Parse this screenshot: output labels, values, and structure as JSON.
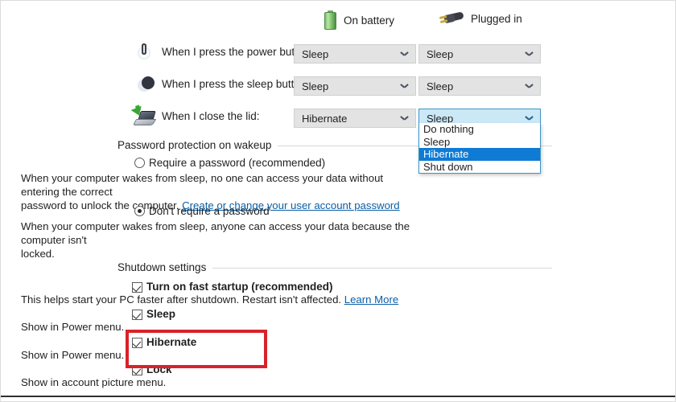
{
  "columns": [
    {
      "icon": "battery-icon",
      "label": "On battery"
    },
    {
      "icon": "power-plug-icon",
      "label": "Plugged in"
    }
  ],
  "setting_rows": [
    {
      "icon": "power-button-icon",
      "label": "When I press the power button:",
      "on_battery": "Sleep",
      "plugged_in": "Sleep"
    },
    {
      "icon": "sleep-button-icon",
      "label": "When I press the sleep button:",
      "on_battery": "Sleep",
      "plugged_in": "Sleep"
    },
    {
      "icon": "close-lid-icon",
      "label": "When I close the lid:",
      "on_battery": "Hibernate",
      "plugged_in": "Sleep"
    }
  ],
  "dropdown": {
    "open_for": "close-lid-plugged-in",
    "current_value": "Sleep",
    "highlighted": "Hibernate",
    "options": [
      "Do nothing",
      "Sleep",
      "Hibernate",
      "Shut down"
    ]
  },
  "password_section": {
    "title": "Password protection on wakeup",
    "options": [
      {
        "label": "Require a password (recommended)",
        "selected": false,
        "desc_part1": "When your computer wakes from sleep, no one can access your data without entering the correct",
        "desc_part2": "password to unlock the computer.",
        "link": "Create or change your user account password"
      },
      {
        "label": "Don't require a password",
        "selected": true,
        "desc_part1": "When your computer wakes from sleep, anyone can access your data because the computer isn't",
        "desc_part2": "locked.",
        "link": ""
      }
    ]
  },
  "shutdown_section": {
    "title": "Shutdown settings",
    "items": [
      {
        "label": "Turn on fast startup (recommended)",
        "checked": true,
        "desc": "This helps start your PC faster after shutdown. Restart isn't affected.",
        "link": "Learn More",
        "highlighted": false
      },
      {
        "label": "Sleep",
        "checked": true,
        "desc": "Show in Power menu.",
        "link": "",
        "highlighted": false
      },
      {
        "label": "Hibernate",
        "checked": true,
        "desc": "Show in Power menu.",
        "link": "",
        "highlighted": true
      },
      {
        "label": "Lock",
        "checked": true,
        "desc": "Show in account picture menu.",
        "link": "",
        "highlighted": false
      }
    ]
  },
  "colors": {
    "annotation": "#d8222a",
    "selection": "#0f7bd4",
    "link": "#0a5fa6",
    "combo_bg": "#e3e3e3",
    "combo_open_bg": "#cbe8f7",
    "battery_green": "#7cbf6f"
  }
}
